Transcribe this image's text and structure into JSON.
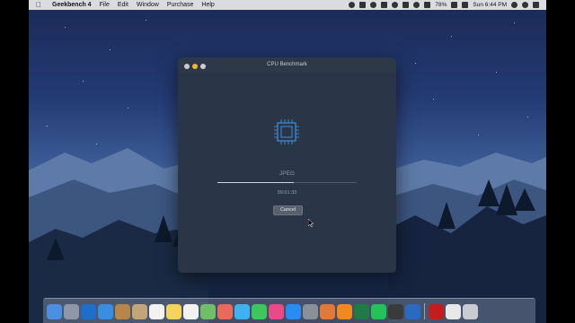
{
  "menubar": {
    "app_name": "Geekbench 4",
    "menus": [
      "File",
      "Edit",
      "Window",
      "Purchase",
      "Help"
    ],
    "battery": "78%",
    "clock": "Sun 6:44 PM"
  },
  "window": {
    "title": "CPU Benchmark",
    "task": "JPEG",
    "progress": 0.55,
    "elapsed": "00:01:33",
    "cancel_label": "Cancel"
  },
  "dock": {
    "icons": [
      {
        "name": "finder-icon",
        "color": "#4a8fe0"
      },
      {
        "name": "launchpad-icon",
        "color": "#8f98a8"
      },
      {
        "name": "outlook-icon",
        "color": "#1e6fc9"
      },
      {
        "name": "safari-icon",
        "color": "#3a8ee0"
      },
      {
        "name": "notefile-icon",
        "color": "#b8864a"
      },
      {
        "name": "contacts-icon",
        "color": "#c2a67a"
      },
      {
        "name": "calendar-icon",
        "color": "#f2f2f2"
      },
      {
        "name": "notes-icon",
        "color": "#f4d35e"
      },
      {
        "name": "reminders-icon",
        "color": "#f2f2f2"
      },
      {
        "name": "maps-icon",
        "color": "#6fbf6a"
      },
      {
        "name": "photos-icon",
        "color": "#e86a5a"
      },
      {
        "name": "messages-icon",
        "color": "#3fb0f0"
      },
      {
        "name": "facetime-icon",
        "color": "#3cc85a"
      },
      {
        "name": "itunes-icon",
        "color": "#e84a8a"
      },
      {
        "name": "app-store-icon",
        "color": "#2a8cf0"
      },
      {
        "name": "system-preferences-icon",
        "color": "#8a8f98"
      },
      {
        "name": "crossover-icon",
        "color": "#e07a3a"
      },
      {
        "name": "vlc-icon",
        "color": "#f08a20"
      },
      {
        "name": "excel-icon",
        "color": "#1f7a45"
      },
      {
        "name": "whatsapp-icon",
        "color": "#25c25a"
      },
      {
        "name": "obs-icon",
        "color": "#3a3a3a"
      },
      {
        "name": "geekbench-icon",
        "color": "#2a6ac0"
      },
      {
        "name": "acrobat-icon",
        "color": "#c21e1e"
      },
      {
        "name": "document-icon",
        "color": "#e8e8e8"
      },
      {
        "name": "trash-icon",
        "color": "#c8ccd2"
      }
    ]
  }
}
